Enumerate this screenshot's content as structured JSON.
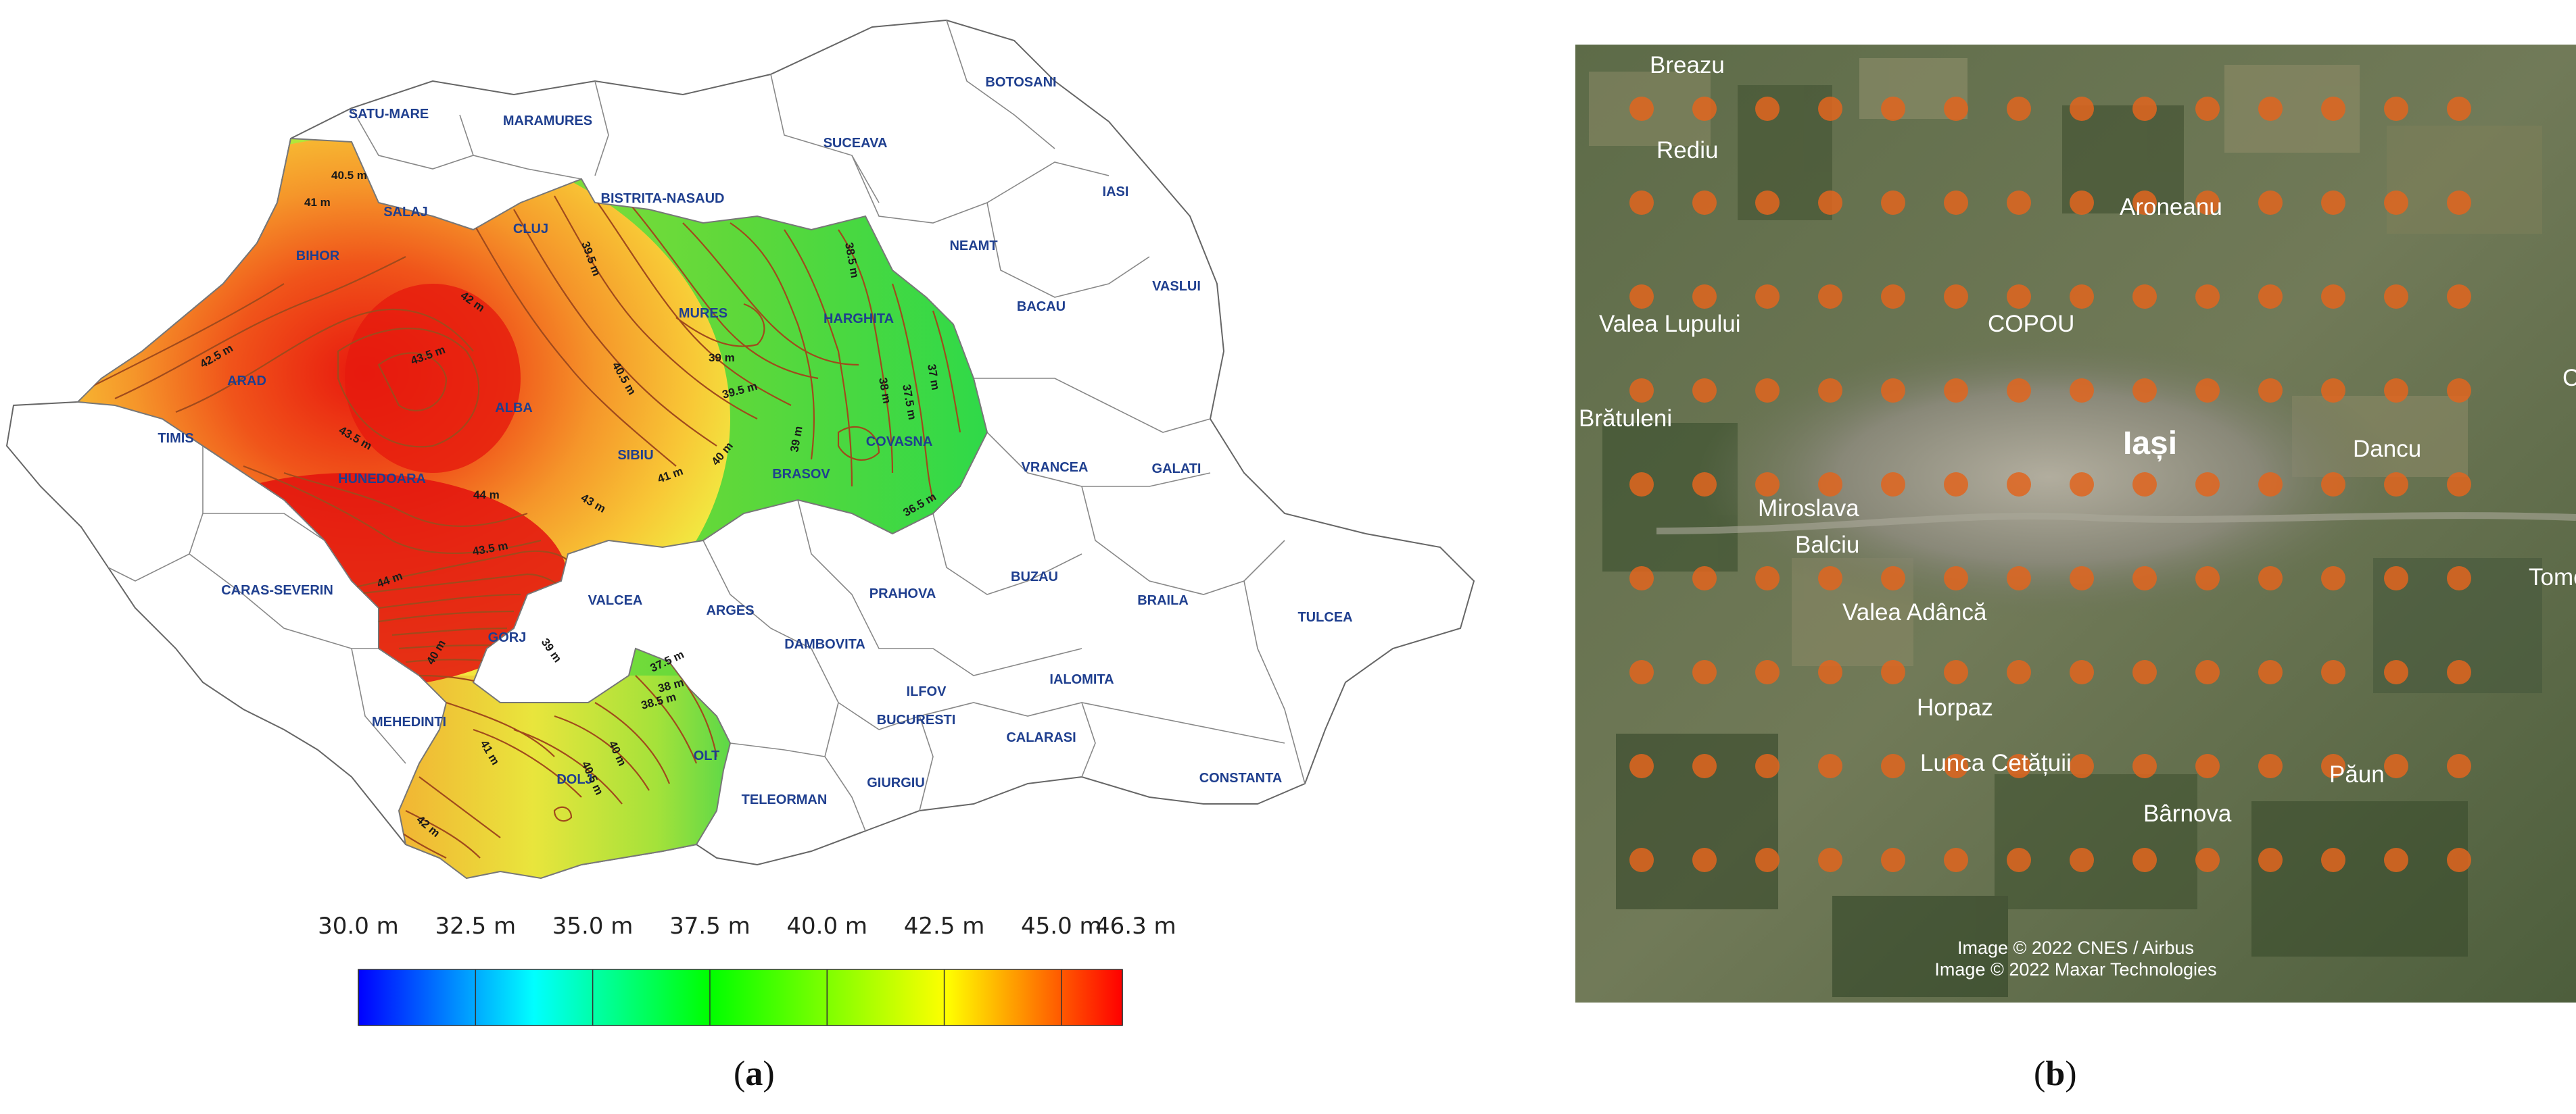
{
  "panel_a": {
    "caption": "a",
    "counties": [
      "SATU-MARE",
      "MARAMURES",
      "BOTOSANI",
      "SUCEAVA",
      "IASI",
      "BISTRITA-NASAUD",
      "SALAJ",
      "NEAMT",
      "BIHOR",
      "CLUJ",
      "MURES",
      "HARGHITA",
      "BACAU",
      "VASLUI",
      "ARAD",
      "ALBA",
      "COVASNA",
      "SIBIU",
      "BRASOV",
      "VRANCEA",
      "GALATI",
      "TIMIS",
      "HUNEDOARA",
      "BUZAU",
      "PRAHOVA",
      "BRAILA",
      "TULCEA",
      "CARAS-SEVERIN",
      "VALCEA",
      "ARGES",
      "GORJ",
      "DAMBOVITA",
      "ILFOV",
      "IALOMITA",
      "BUCURESTI",
      "CALARASI",
      "MEHEDINTI",
      "OLT",
      "DOLJ",
      "TELEORMAN",
      "GIURGIU",
      "CONSTANTA"
    ],
    "contour_labels": [
      "40.5 m",
      "41 m",
      "42.5 m",
      "43.5 m",
      "42 m",
      "39.5 m",
      "39 m",
      "38.5 m",
      "43.5 m",
      "40.5 m",
      "39.5 m",
      "38 m",
      "37.5 m",
      "37 m",
      "44 m",
      "43 m",
      "41 m",
      "40 m",
      "39 m",
      "36.5 m",
      "43.5 m",
      "44 m",
      "40 m",
      "39 m",
      "37.5 m",
      "38 m",
      "38.5 m",
      "41 m",
      "40 m",
      "40.5 m",
      "42 m"
    ],
    "colorbar": {
      "ticks": [
        "30.0 m",
        "32.5 m",
        "35.0 m",
        "37.5 m",
        "40.0 m",
        "42.5 m",
        "45.0 m",
        "46.3 m"
      ],
      "min": 30.0,
      "max": 46.3,
      "colors": [
        "#0000ff",
        "#00ffff",
        "#00ff00",
        "#ffff00",
        "#ff0000"
      ]
    }
  },
  "panel_b": {
    "caption": "b",
    "places": [
      "Breazu",
      "Rediu",
      "Aroneanu",
      "Valea Lupului",
      "COPOU",
      "Brătuleni",
      "Iași",
      "Dancu",
      "Miroslava",
      "Balciu",
      "Tome",
      "Valea Adâncă",
      "Horpaz",
      "Lunca Cetățuii",
      "Păun",
      "Bârnova",
      "C"
    ],
    "attribution": [
      "Image © 2022 CNES / Airbus",
      "Image © 2022 Maxar Technologies"
    ],
    "marker_color": "#e0651e",
    "grid": {
      "rows": 9,
      "cols": 14
    }
  }
}
